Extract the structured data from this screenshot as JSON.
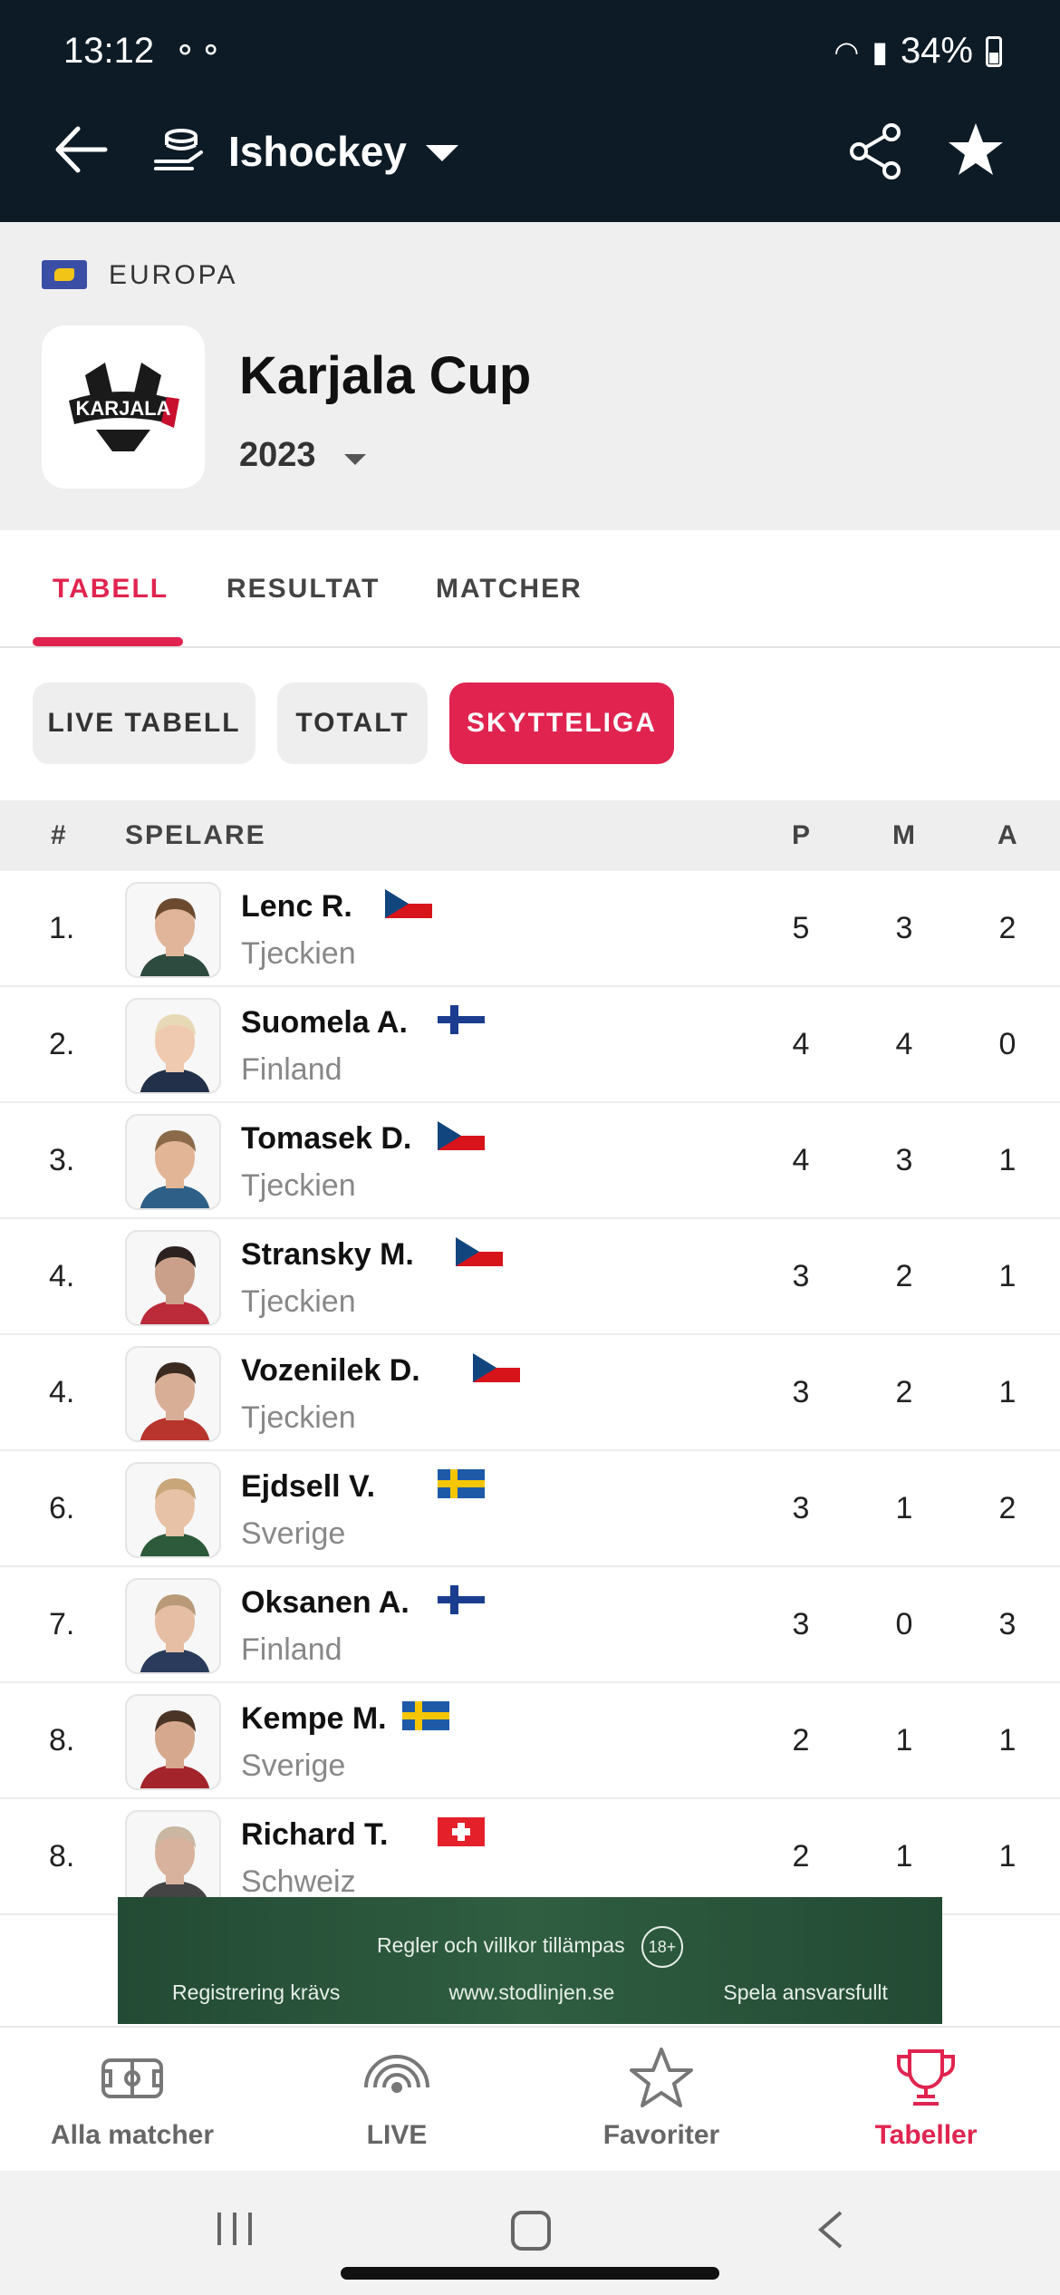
{
  "status_bar": {
    "time": "13:12",
    "battery": "34%"
  },
  "app_bar": {
    "sport": "Ishockey"
  },
  "header": {
    "region": "EUROPA",
    "league_logo_text": "KARJALA",
    "league": "Karjala Cup",
    "season": "2023"
  },
  "tabs": [
    {
      "label": "TABELL",
      "active": true
    },
    {
      "label": "RESULTAT",
      "active": false
    },
    {
      "label": "MATCHER",
      "active": false
    }
  ],
  "chips": [
    {
      "label": "LIVE TABELL",
      "active": false
    },
    {
      "label": "TOTALT",
      "active": false
    },
    {
      "label": "SKYTTELIGA",
      "active": true
    }
  ],
  "table": {
    "headers": {
      "rank": "#",
      "player": "SPELARE",
      "p": "P",
      "m": "M",
      "a": "A"
    },
    "rows": [
      {
        "rank": "1.",
        "name": "Lenc R.",
        "country": "Tjeckien",
        "flag": "czech",
        "p": "5",
        "m": "3",
        "a": "2"
      },
      {
        "rank": "2.",
        "name": "Suomela A.",
        "country": "Finland",
        "flag": "finland",
        "p": "4",
        "m": "4",
        "a": "0"
      },
      {
        "rank": "3.",
        "name": "Tomasek D.",
        "country": "Tjeckien",
        "flag": "czech",
        "p": "4",
        "m": "3",
        "a": "1"
      },
      {
        "rank": "4.",
        "name": "Stransky M.",
        "country": "Tjeckien",
        "flag": "czech",
        "p": "3",
        "m": "2",
        "a": "1"
      },
      {
        "rank": "4.",
        "name": "Vozenilek D.",
        "country": "Tjeckien",
        "flag": "czech",
        "p": "3",
        "m": "2",
        "a": "1"
      },
      {
        "rank": "6.",
        "name": "Ejdsell V.",
        "country": "Sverige",
        "flag": "sweden",
        "p": "3",
        "m": "1",
        "a": "2"
      },
      {
        "rank": "7.",
        "name": "Oksanen A.",
        "country": "Finland",
        "flag": "finland",
        "p": "3",
        "m": "0",
        "a": "3"
      },
      {
        "rank": "8.",
        "name": "Kempe M.",
        "country": "Sverige",
        "flag": "sweden",
        "p": "2",
        "m": "1",
        "a": "1"
      },
      {
        "rank": "8.",
        "name": "Richard T.",
        "country": "Schweiz",
        "flag": "switzerland",
        "p": "2",
        "m": "1",
        "a": "1"
      }
    ]
  },
  "ad": {
    "line1": "Regler och villkor tillämpas",
    "badge": "18+",
    "left": "Registrering krävs",
    "center": "www.stodlinjen.se",
    "right": "Spela ansvarsfullt"
  },
  "bottom_nav": [
    {
      "label": "Alla matcher",
      "icon": "field-icon",
      "active": false
    },
    {
      "label": "LIVE",
      "icon": "live-icon",
      "active": false
    },
    {
      "label": "Favoriter",
      "icon": "star-outline-icon",
      "active": false
    },
    {
      "label": "Tabeller",
      "icon": "trophy-icon",
      "active": true
    }
  ],
  "colors": {
    "accent": "#e0244f",
    "topbar": "#0d1b26",
    "header_bg": "#efeff0"
  }
}
